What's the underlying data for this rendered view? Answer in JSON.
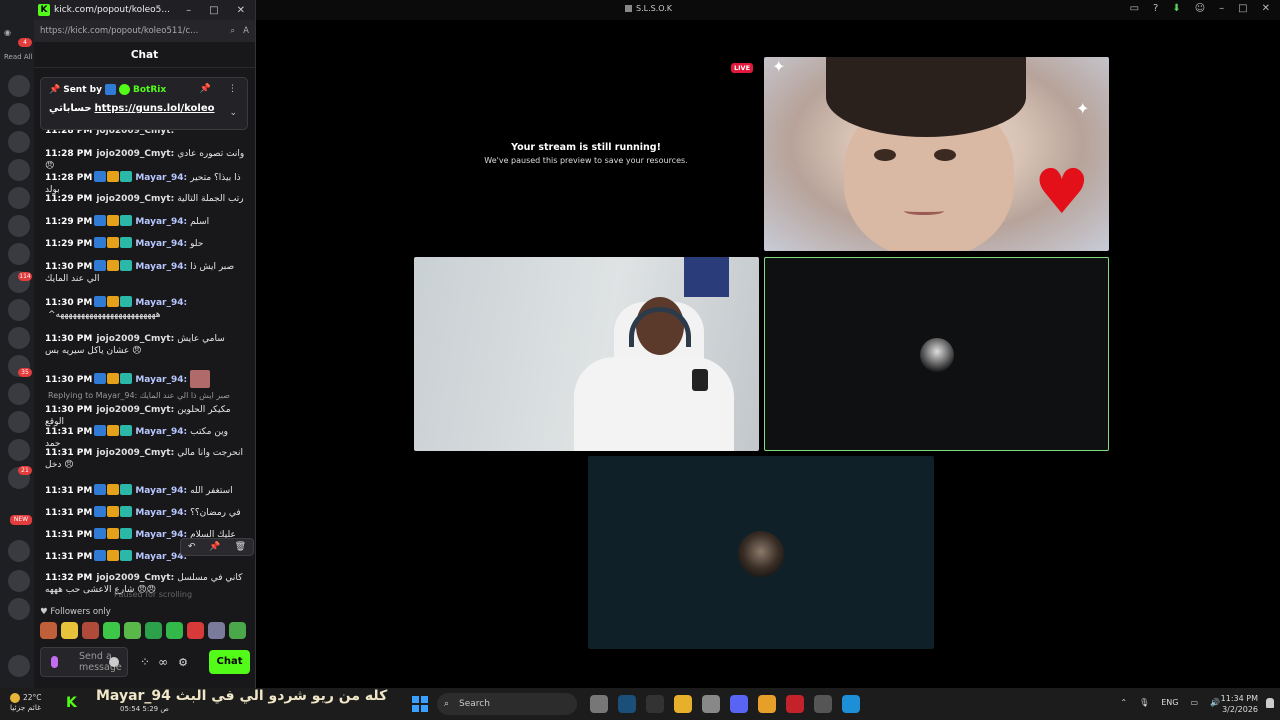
{
  "app": {
    "title": "S.L.S.O.K"
  },
  "taskbar_top_icons": [
    "tv-icon",
    "help-icon",
    "download-icon",
    "people-icon"
  ],
  "left_strip": {
    "read_all": "Read All",
    "badges": [
      "4",
      "114",
      "35",
      "21",
      "NEW"
    ]
  },
  "popout": {
    "window_title": "kick.com/popout/koleo5...",
    "url": "https://kick.com/popout/koleo511/c...",
    "url_host": "kick.com",
    "chat_header": "Chat",
    "pinned": {
      "sent_by": "Sent by",
      "bot_name": "BotRix",
      "text_ar": "حساباتي",
      "link": "https://guns.lol/koleo"
    },
    "messages": [
      {
        "time": "11:28 PM",
        "user": "jojo2009_Cmyt:",
        "text": "",
        "badges": 0
      },
      {
        "time": "11:28 PM",
        "user": "jojo2009_Cmyt:",
        "text": "وانت تصوره عادي 😠",
        "badges": 0
      },
      {
        "time": "11:28 PM",
        "user": "Mayar_94:",
        "text": "ذا بيذا؟ متحير بولد",
        "badges": 3
      },
      {
        "time": "11:29 PM",
        "user": "jojo2009_Cmyt:",
        "text": "رتب الجملة التالية",
        "badges": 0
      },
      {
        "time": "11:29 PM",
        "user": "Mayar_94:",
        "text": "اسلم",
        "badges": 3
      },
      {
        "time": "11:29 PM",
        "user": "Mayar_94:",
        "text": "حلو",
        "badges": 3
      },
      {
        "time": "11:30 PM",
        "user": "Mayar_94:",
        "text": "صبر ايش ذا الي عند المايك",
        "badges": 3
      },
      {
        "time": "11:30 PM",
        "user": "Mayar_94:",
        "text": "^ههههههههههههههههههههههههه",
        "badges": 3
      },
      {
        "time": "11:30 PM",
        "user": "jojo2009_Cmyt:",
        "text": "سامي عايش عشان ياكل سيريه بس 😠",
        "badges": 0
      },
      {
        "time": "11:30 PM",
        "user": "Mayar_94:",
        "text": "",
        "badges": 3
      },
      {
        "time": "11:30 PM",
        "user": "jojo2009_Cmyt:",
        "text": "مكيكر الحلوين الوقع",
        "badges": 0
      },
      {
        "time": "11:31 PM",
        "user": "Mayar_94:",
        "text": "وين مكتب حمد",
        "badges": 3
      },
      {
        "time": "11:31 PM",
        "user": "jojo2009_Cmyt:",
        "text": "انحرجت وانا مالي دخل 😠",
        "badges": 0
      },
      {
        "time": "11:31 PM",
        "user": "Mayar_94:",
        "text": "استغفر الله",
        "badges": 3
      },
      {
        "time": "11:31 PM",
        "user": "Mayar_94:",
        "text": "في رمضان؟؟",
        "badges": 3
      },
      {
        "time": "11:31 PM",
        "user": "Mayar_94:",
        "text": "عليك السلام",
        "badges": 3
      },
      {
        "time": "11:31 PM",
        "user": "Mayar_94:",
        "text": "",
        "badges": 3
      },
      {
        "time": "11:32 PM",
        "user": "jojo2009_Cmyt:",
        "text": "كاني في مسلسل شارع الاعشى حب هههه 😠😠",
        "badges": 0
      }
    ],
    "reply_line": "Replying to Mayar_94: صبر ايش ذا الي عند المايك",
    "scroll_hint": "Paused for scrolling",
    "followers_only": "Followers only",
    "input_placeholder": "Send a message",
    "chat_button": "Chat"
  },
  "stream": {
    "live": "LIVE",
    "paused_title": "Your stream is still running!",
    "paused_sub": "We've paused this preview to save your resources."
  },
  "taskbar": {
    "temp": "22°C",
    "weather_sub": "غائم جزئيا",
    "overlay_name": "Mayar_94",
    "overlay_text": "كله من ريو شردو الي في البث",
    "overlay_sub": "05:54 ص  5:29",
    "search": "Search",
    "lang": "ENG",
    "time": "11:34 PM",
    "date": "3/2/2026"
  }
}
